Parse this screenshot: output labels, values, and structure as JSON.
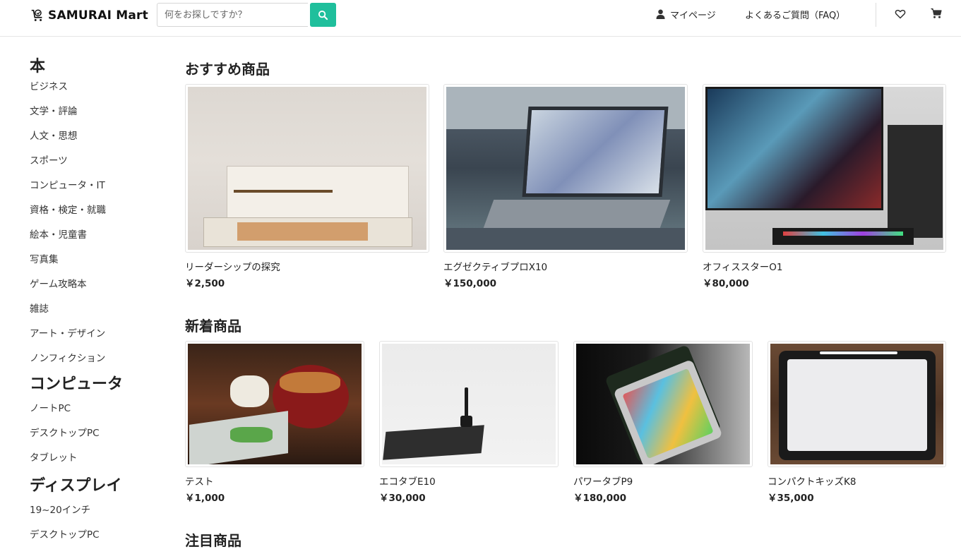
{
  "header": {
    "logo_text": "SAMURAI Mart",
    "search_placeholder": "何をお探しですか？",
    "mypage_label": "マイページ",
    "faq_label": "よくあるご質問（FAQ）"
  },
  "sidebar": {
    "categories": [
      {
        "title": "本",
        "items": [
          "ビジネス",
          "文学・評論",
          "人文・思想",
          "スポーツ",
          "コンピュータ・IT",
          "資格・検定・就職",
          "絵本・児童書",
          "写真集",
          "ゲーム攻略本",
          "雑誌",
          "アート・デザイン",
          "ノンフィクション"
        ]
      },
      {
        "title": "コンピュータ",
        "items": [
          "ノートPC",
          "デスクトップPC",
          "タブレット"
        ]
      },
      {
        "title": "ディスプレイ",
        "items": [
          "19~20インチ",
          "デスクトップPC"
        ]
      }
    ]
  },
  "main": {
    "recommended": {
      "title": "おすすめ商品",
      "products": [
        {
          "name": "リーダーシップの探究",
          "price": "￥2,500",
          "image": "books-photo"
        },
        {
          "name": "エグゼクティブプロX10",
          "price": "￥150,000",
          "image": "laptop-photo"
        },
        {
          "name": "オフィススターO1",
          "price": "￥80,000",
          "image": "desktop-pc-photo"
        }
      ]
    },
    "new_arrivals": {
      "title": "新着商品",
      "products": [
        {
          "name": "テスト",
          "price": "￥1,000",
          "image": "food-photo"
        },
        {
          "name": "エコタブE10",
          "price": "￥30,000",
          "image": "pen-tablet-photo"
        },
        {
          "name": "パワータブP9",
          "price": "￥180,000",
          "image": "ipad-photo"
        },
        {
          "name": "コンパクトキッズK8",
          "price": "￥35,000",
          "image": "drawing-tablet-photo"
        }
      ]
    },
    "featured": {
      "title": "注目商品"
    }
  },
  "colors": {
    "accent": "#1fbf9c",
    "border": "#e2e2e2"
  }
}
